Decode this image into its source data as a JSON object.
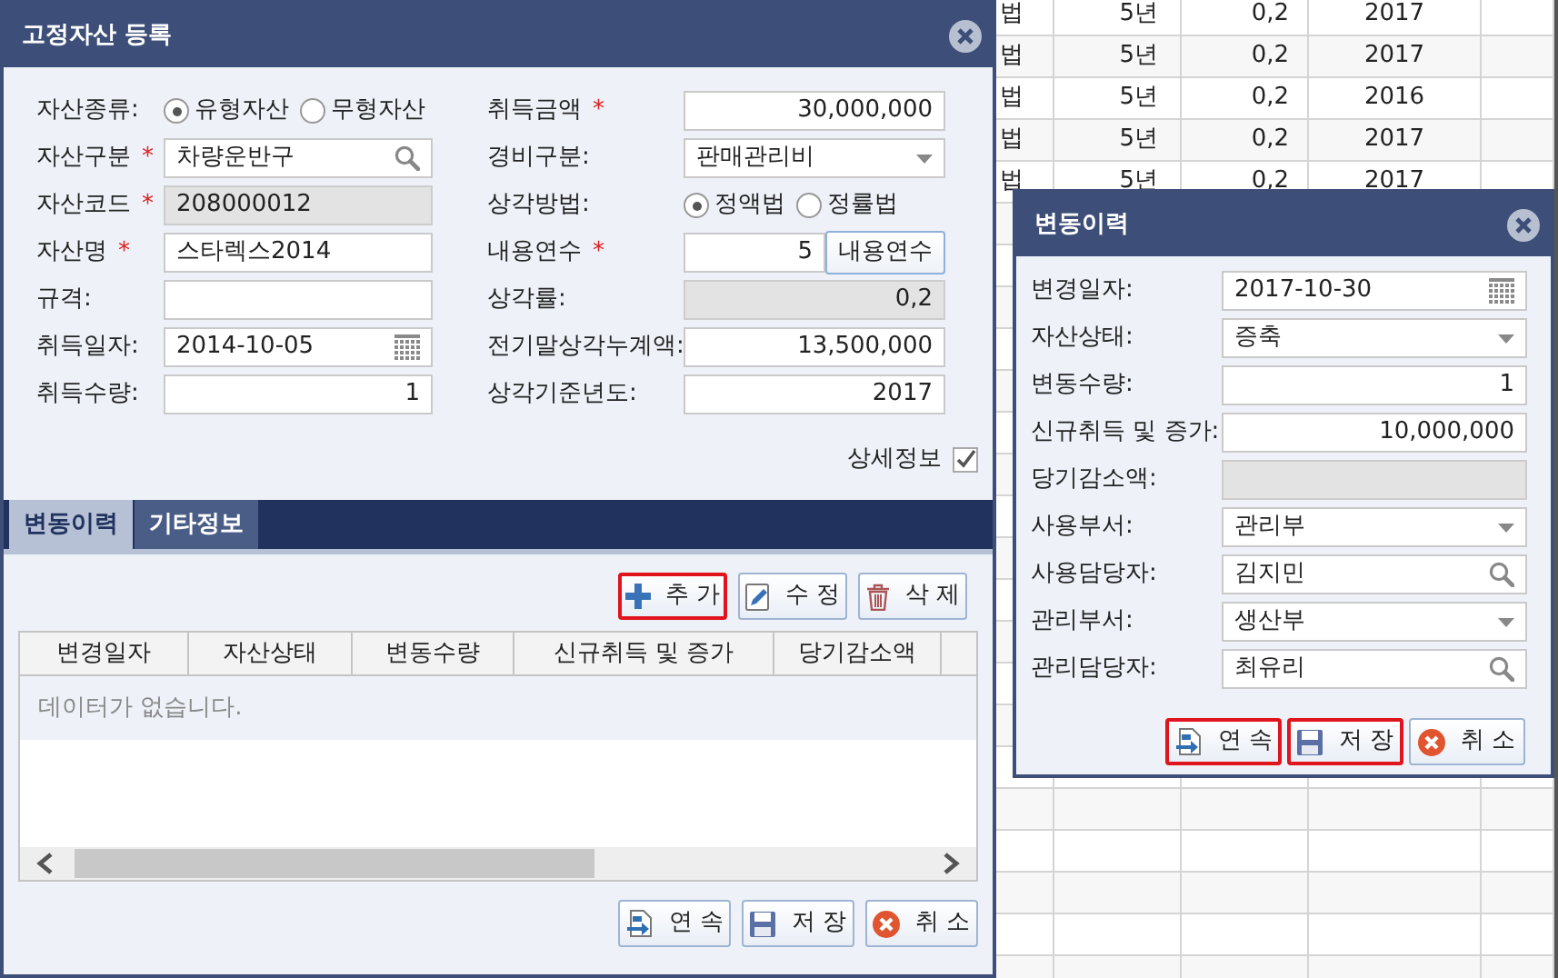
{
  "background_table": {
    "rows": [
      {
        "column_1": "법",
        "column_2": "5년",
        "column_3": "0,2",
        "column_4": "2017"
      },
      {
        "column_1": "법",
        "column_2": "5년",
        "column_3": "0,2",
        "column_4": "2017"
      },
      {
        "column_1": "법",
        "column_2": "5년",
        "column_3": "0,2",
        "column_4": "2016"
      },
      {
        "column_1": "법",
        "column_2": "5년",
        "column_3": "0,2",
        "column_4": "2017"
      },
      {
        "column_1": "법",
        "column_2": "5년",
        "column_3": "0,2",
        "column_4": "2017"
      }
    ]
  },
  "dialog": {
    "title": "고정자산 등록",
    "left_fields": [
      {
        "label": "자산종류:",
        "kind": "radio",
        "options": [
          {
            "label": "유형자산",
            "selected": true
          },
          {
            "label": "무형자산",
            "selected": false
          }
        ]
      },
      {
        "label": "자산구분",
        "required_mark": "*",
        "kind": "search",
        "value": "차량운반구"
      },
      {
        "label": "자산코드",
        "required_mark": "*",
        "kind": "readonly",
        "value": "208000012"
      },
      {
        "label": "자산명",
        "required_mark": "*",
        "kind": "text",
        "value": "스타렉스2014"
      },
      {
        "label": "규격:",
        "kind": "text"
      },
      {
        "label": "취득일자:",
        "kind": "date",
        "value": "2014-10-05"
      },
      {
        "label": "취득수량:",
        "kind": "number",
        "value": "1"
      }
    ],
    "right_fields": [
      {
        "label": "취득금액",
        "required_mark": "*",
        "kind": "number",
        "value": "30,000,000"
      },
      {
        "label": "경비구분:",
        "kind": "select",
        "value": "판매관리비"
      },
      {
        "label": "상각방법:",
        "kind": "radio",
        "options": [
          {
            "label": "정액법",
            "selected": true
          },
          {
            "label": "정률법",
            "selected": false
          }
        ]
      },
      {
        "label": "내용연수",
        "required_mark": "*",
        "kind": "number_button",
        "value": "5",
        "button": "내용연수"
      },
      {
        "label": "상각률:",
        "kind": "readonly_number",
        "value": "0,2"
      },
      {
        "label": "전기말상각누계액:",
        "kind": "number",
        "value": "13,500,000"
      },
      {
        "label": "상각기준년도:",
        "kind": "number",
        "value": "2017"
      }
    ],
    "detail_checkbox": {
      "label": "상세정보",
      "checked": true
    },
    "tabs": [
      {
        "label": "변동이력",
        "selected": true
      },
      {
        "label": "기타정보",
        "selected": false
      }
    ],
    "toolbar": [
      {
        "label": "추 가",
        "kind": "add",
        "highlighted": true
      },
      {
        "label": "수 정",
        "kind": "edit",
        "highlighted": false
      },
      {
        "label": "삭 제",
        "kind": "delete",
        "highlighted": false
      }
    ],
    "grid": {
      "columns": [
        "변경일자",
        "자산상태",
        "변동수량",
        "신규취득 및 증가",
        "당기감소액"
      ],
      "empty_message": "데이터가 없습니다."
    },
    "buttons": [
      {
        "label": "연 속",
        "kind": "continue",
        "highlighted": false
      },
      {
        "label": "저 장",
        "kind": "save",
        "highlighted": false
      },
      {
        "label": "취 소",
        "kind": "cancel",
        "highlighted": false
      }
    ]
  },
  "sub_dialog": {
    "title": "변동이력",
    "fields": [
      {
        "label": "변경일자:",
        "kind": "date",
        "value": "2017-10-30"
      },
      {
        "label": "자산상태:",
        "kind": "select",
        "value": "증축"
      },
      {
        "label": "변동수량:",
        "kind": "number",
        "value": "1"
      },
      {
        "label": "신규취득 및 증가:",
        "kind": "number",
        "value": "10,000,000"
      },
      {
        "label": "당기감소액:",
        "kind": "readonly"
      },
      {
        "label": "사용부서:",
        "kind": "select",
        "value": "관리부"
      },
      {
        "label": "사용담당자:",
        "kind": "search",
        "value": "김지민"
      },
      {
        "label": "관리부서:",
        "kind": "select",
        "value": "생산부"
      },
      {
        "label": "관리담당자:",
        "kind": "search",
        "value": "최유리"
      }
    ],
    "buttons": [
      {
        "label": "연 속",
        "kind": "continue",
        "highlighted": true
      },
      {
        "label": "저 장",
        "kind": "save",
        "highlighted": true
      },
      {
        "label": "취 소",
        "kind": "cancel",
        "highlighted": false
      }
    ]
  }
}
